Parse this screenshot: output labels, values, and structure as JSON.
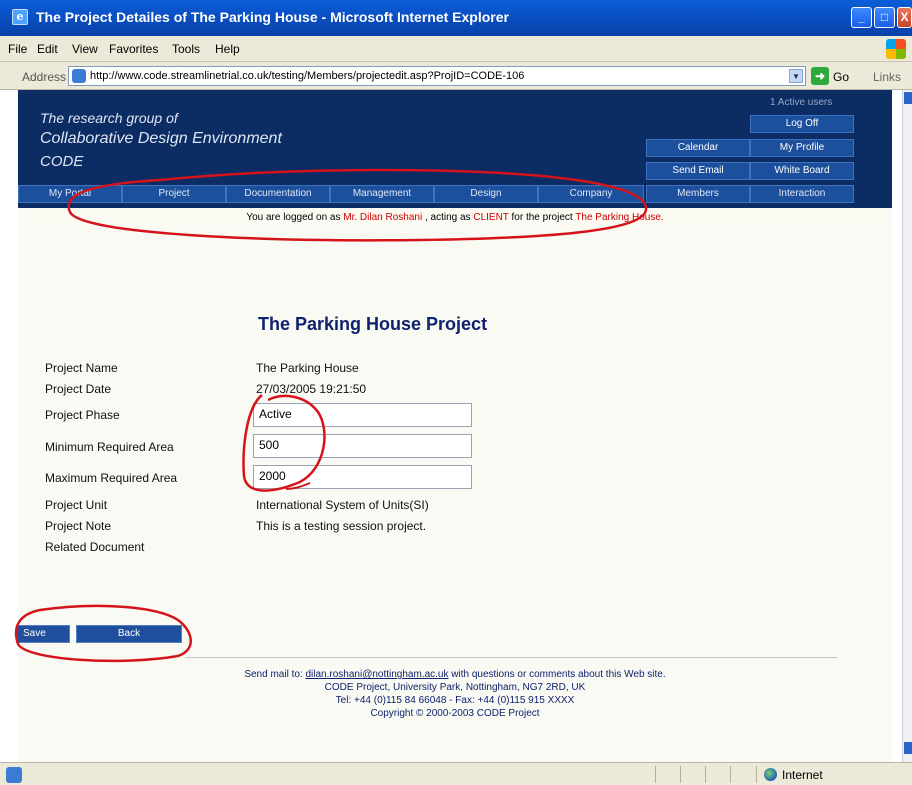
{
  "window": {
    "title": "The Project Detailes of The Parking House - Microsoft Internet Explorer",
    "icon": "ie-page-icon",
    "buttons": {
      "minimize": "_",
      "maximize": "□",
      "close": "X"
    }
  },
  "menu": [
    "File",
    "Edit",
    "View",
    "Favorites",
    "Tools",
    "Help"
  ],
  "address": {
    "label": "Address",
    "url": "http://www.code.streamlinetrial.co.uk/testing/Members/projectedit.asp?ProjID=CODE-106",
    "go": "Go",
    "links": "Links"
  },
  "site": {
    "tagline1": "The research group of",
    "tagline2": "Collaborative Design Environment",
    "tagline3": "CODE",
    "active_users": "1 Active users",
    "buttons": {
      "log_off": "Log Off",
      "calendar": "Calendar",
      "my_profile": "My Profile",
      "send_email": "Send Email",
      "white_board": "White Board"
    },
    "nav": [
      "My Portal",
      "Project",
      "Documentation",
      "Management",
      "Design",
      "Company",
      "Members",
      "Interaction"
    ]
  },
  "logon": {
    "prefix": "You are logged on as",
    "user": "Mr. Dilan  Roshani",
    "middle": ", acting as",
    "role": "CLIENT",
    "suffix": "for the project",
    "project": "The Parking House."
  },
  "project": {
    "heading": "The Parking House  Project",
    "fields": {
      "name_label": "Project Name",
      "name_value": "The Parking House",
      "date_label": "Project Date",
      "date_value": "27/03/2005 19:21:50",
      "phase_label": "Project Phase",
      "phase_value": "Active",
      "min_label": "Minimum Required Area",
      "min_value": "500",
      "max_label": "Maximum Required Area",
      "max_value": "2000",
      "unit_label": "Project Unit",
      "unit_value": "International System of Units(SI)",
      "note_label": "Project Note",
      "note_value": "This is a testing session project.",
      "doc_label": "Related Document"
    }
  },
  "actions": {
    "save": "Save",
    "back": "Back"
  },
  "footer": {
    "send_mail_prefix": "Send mail to:",
    "email": "dilan.roshani@nottingham.ac.uk",
    "send_mail_suffix": "with questions or comments about this Web site.",
    "address": "CODE Project, University Park, Nottingham, NG7 2RD, UK",
    "phone": "Tel: +44 (0)115 84 66048 - Fax: +44 (0)115 915 XXXX",
    "copyright": "Copyright © 2000-2003 CODE Project"
  },
  "status": {
    "zone": "Internet"
  },
  "colors": {
    "header_bg": "#0c2d63",
    "button_bg": "#1c4f9c",
    "title_blue": "#10216d",
    "highlight_red": "#c00000",
    "annotation_red": "#d4141a"
  }
}
